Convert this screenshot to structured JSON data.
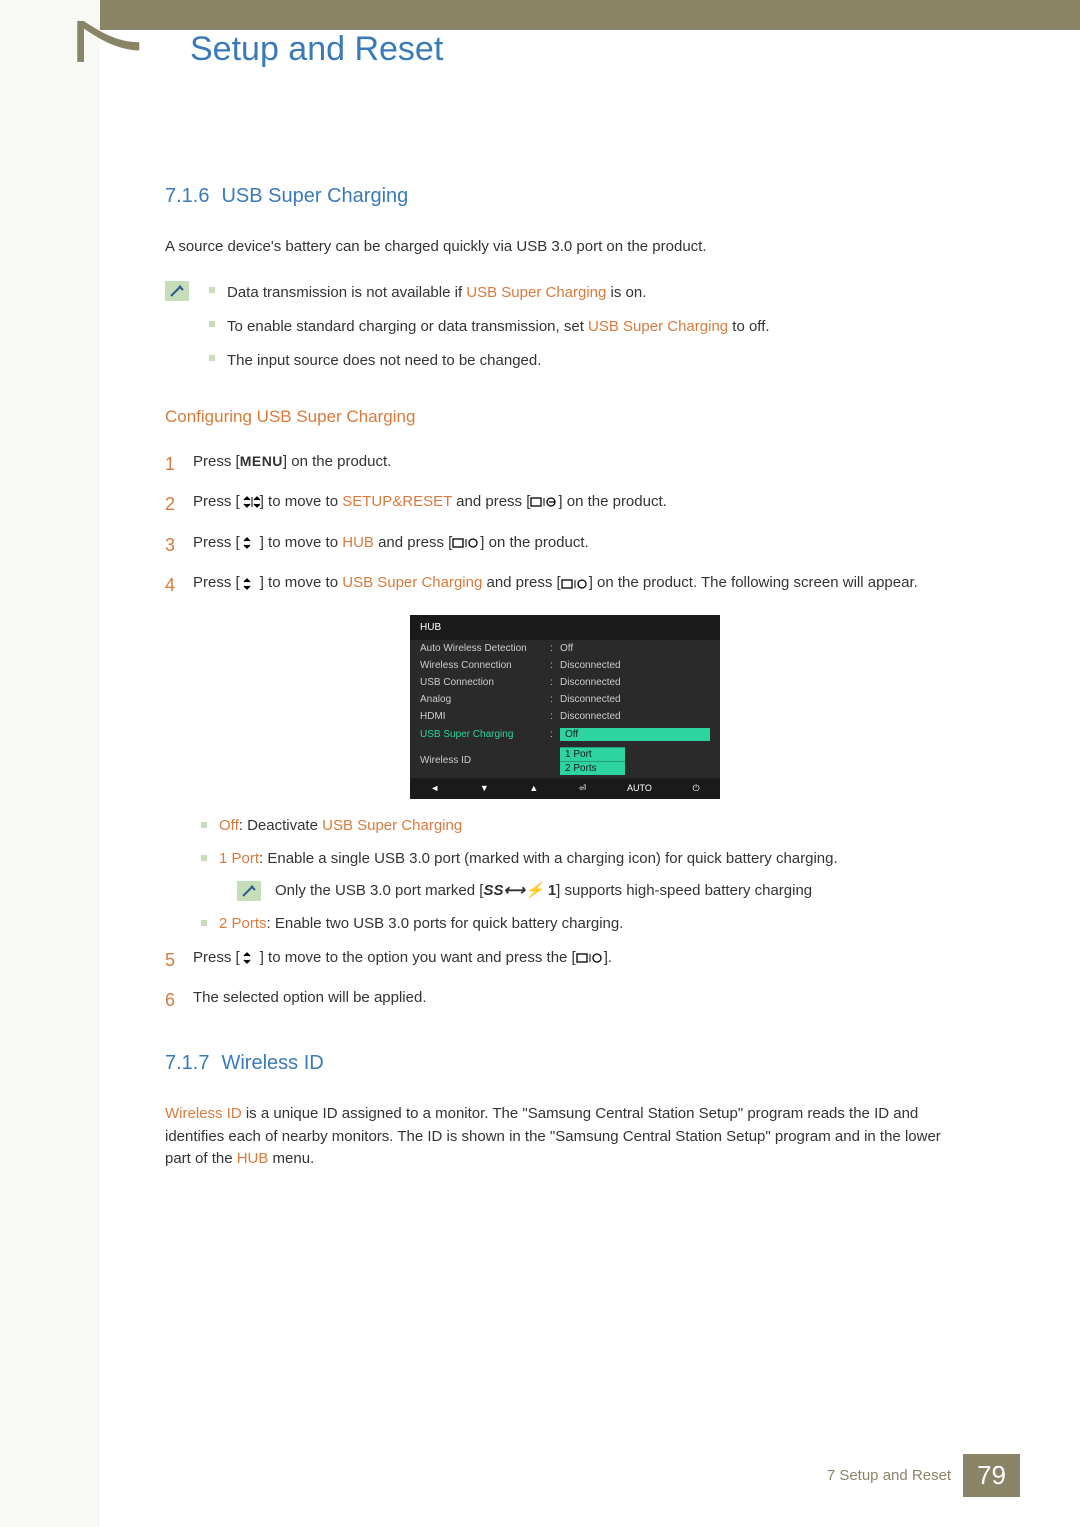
{
  "chapter_number": "7",
  "page_title": "Setup and Reset",
  "section_716": {
    "num": "7.1.6",
    "title": "USB Super Charging",
    "intro": "A source device's battery can be charged quickly via USB 3.0 port on the product.",
    "notes": {
      "n1a": "Data transmission is not available if ",
      "n1b": " is on.",
      "n2a": "To enable standard charging or data transmission, set ",
      "n2b": " to off.",
      "n3": "The input source does not need to be changed."
    },
    "sub_heading": "Configuring USB Super Charging",
    "steps": {
      "s1": "Press [",
      "s1b": "] on the product.",
      "menu_word": "MENU",
      "s2a": "Press [",
      "s2b": "] to move to ",
      "s2c": " and press [",
      "s2d": "] on the product.",
      "setup_reset": "SETUP&RESET",
      "s3a": "Press [",
      "s3b": "] to move to ",
      "hub": "HUB",
      "s3c": " and press [",
      "s3d": "] on the product.",
      "s4a": "Press [",
      "s4b": "] to move to ",
      "usc": "USB Super Charging",
      "s4c": " and press [",
      "s4d": "] on the product. The following screen will appear.",
      "s5a": "Press [",
      "s5b": "] to move to the option you want and press the [",
      "s5c": "].",
      "s6": "The selected option will be applied."
    },
    "options": {
      "off_label": "Off",
      "off_text": ": Deactivate ",
      "off_feat": "USB Super Charging",
      "p1_label": "1 Port",
      "p1_text": ": Enable a single USB 3.0 port (marked with a charging icon) for quick battery charging.",
      "p1_note_a": "Only the USB 3.0 port marked [",
      "p1_note_ss": "SS⟷⚡",
      "p1_note_num": "1",
      "p1_note_b": "] supports high-speed battery charging",
      "p2_label": "2 Ports",
      "p2_text": ": Enable two USB 3.0 ports for quick battery charging."
    }
  },
  "osd": {
    "header": "HUB",
    "rows": [
      {
        "label": "Auto Wireless Detection",
        "value": "Off"
      },
      {
        "label": "Wireless Connection",
        "value": "Disconnected"
      },
      {
        "label": "USB Connection",
        "value": "Disconnected"
      },
      {
        "label": "Analog",
        "value": "Disconnected"
      },
      {
        "label": "HDMI",
        "value": "Disconnected"
      }
    ],
    "active": {
      "label": "USB Super Charging",
      "value": "Off"
    },
    "dropdown": [
      "1 Port",
      "2 Ports"
    ],
    "last_row": {
      "label": "Wireless ID",
      "value": ""
    },
    "footer": {
      "auto": "AUTO"
    }
  },
  "section_717": {
    "num": "7.1.7",
    "title": "Wireless ID",
    "text_a": "Wireless ID",
    "text_b": " is a unique ID assigned to a monitor. The \"Samsung Central Station Setup\" program reads the ID and identifies each of nearby monitors. The ID is shown in the \"Samsung Central Station Setup\" program and in the lower part of the ",
    "text_c": "HUB",
    "text_d": " menu."
  },
  "footer": {
    "chapter": "7",
    "text": "Setup and Reset",
    "page": "79"
  }
}
